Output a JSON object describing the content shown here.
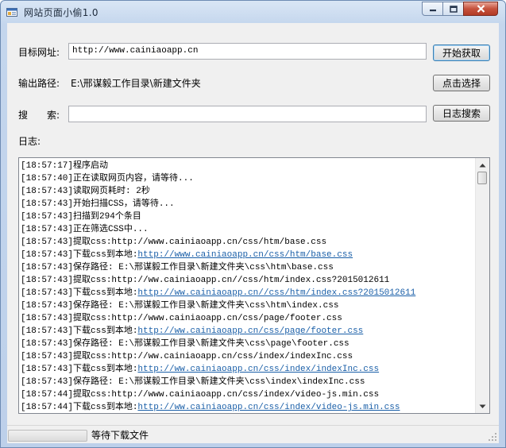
{
  "window": {
    "title": "网站页面小偷1.0"
  },
  "form": {
    "target_label": "目标网址:",
    "target_value": "http://www.cainiaoapp.cn",
    "start_button": "开始获取",
    "output_label": "输出路径:",
    "output_value": "E:\\邢谋毅工作目录\\新建文件夹",
    "choose_button": "点击选择",
    "search_label": "搜　　索:",
    "search_value": "",
    "log_search_button": "日志搜索",
    "log_label": "日志:"
  },
  "log": [
    {
      "text": "[18:57:17]程序启动",
      "url": ""
    },
    {
      "text": "[18:57:40]正在读取网页内容，请等待...",
      "url": ""
    },
    {
      "text": "[18:57:43]读取网页耗时: 2秒",
      "url": ""
    },
    {
      "text": "[18:57:43]开始扫描CSS，请等待...",
      "url": ""
    },
    {
      "text": "[18:57:43]扫描到294个条目",
      "url": ""
    },
    {
      "text": "[18:57:43]正在筛选CSS中...",
      "url": ""
    },
    {
      "text": "[18:57:43]提取css:http://www.cainiaoapp.cn/css/htm/base.css",
      "url": ""
    },
    {
      "text": "[18:57:43]下载css到本地:",
      "url": "http://www.cainiaoapp.cn/css/htm/base.css"
    },
    {
      "text": "[18:57:43]保存路径: E:\\邢谋毅工作目录\\新建文件夹\\css\\htm\\base.css",
      "url": ""
    },
    {
      "text": "[18:57:43]提取css:http://ww.cainiaoapp.cn//css/htm/index.css?2015012611",
      "url": ""
    },
    {
      "text": "[18:57:43]下载css到本地:",
      "url": "http://ww.cainiaoapp.cn//css/htm/index.css?2015012611"
    },
    {
      "text": "[18:57:43]保存路径: E:\\邢谋毅工作目录\\新建文件夹\\css\\htm\\index.css",
      "url": ""
    },
    {
      "text": "[18:57:43]提取css:http://www.cainiaoapp.cn/css/page/footer.css",
      "url": ""
    },
    {
      "text": "[18:57:43]下载css到本地:",
      "url": "http://ww.cainiaoapp.cn/css/page/footer.css"
    },
    {
      "text": "[18:57:43]保存路径: E:\\邢谋毅工作目录\\新建文件夹\\css\\page\\footer.css",
      "url": ""
    },
    {
      "text": "[18:57:43]提取css:http://ww.cainiaoapp.cn/css/index/indexInc.css",
      "url": ""
    },
    {
      "text": "[18:57:43]下载css到本地:",
      "url": "http://ww.cainiaoapp.cn/css/index/indexInc.css"
    },
    {
      "text": "[18:57:43]保存路径: E:\\邢谋毅工作目录\\新建文件夹\\css\\index\\indexInc.css",
      "url": ""
    },
    {
      "text": "[18:57:44]提取css:http://www.cainiaoapp.cn/css/index/video-js.min.css",
      "url": ""
    },
    {
      "text": "[18:57:44]下载css到本地:",
      "url": "http://ww.cainiaoapp.cn/css/index/video-js.min.css"
    }
  ],
  "status": {
    "text": "等待下载文件",
    "progress": 0
  },
  "icons": {
    "window": "app-window-icon",
    "minimize": "minimize-icon",
    "maximize": "maximize-icon",
    "close": "close-icon"
  },
  "colors": {
    "link": "#1a5fa8",
    "close_button": "#c6523d"
  }
}
